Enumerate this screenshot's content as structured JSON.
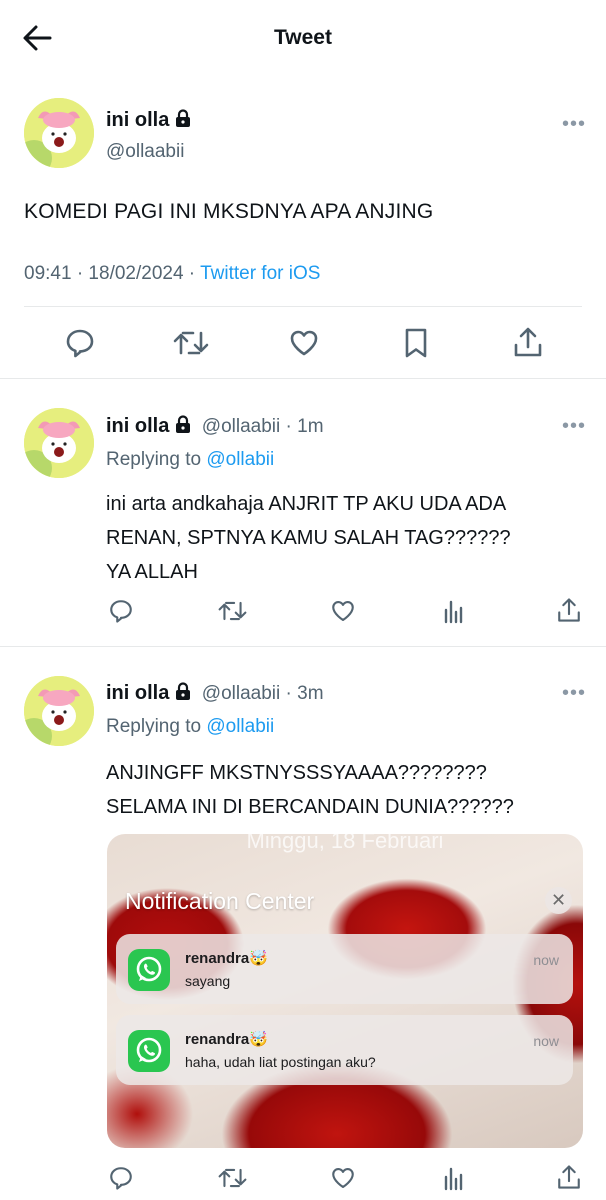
{
  "header": {
    "title": "Tweet"
  },
  "main_tweet": {
    "name": "ini olla",
    "handle": "@ollaabii",
    "text": "KOMEDI PAGI INI MKSDNYA APA ANJING",
    "time": "09:41 · 18/02/2024 · ",
    "source": "Twitter for iOS"
  },
  "reply1": {
    "name": "ini olla",
    "handle": "@ollaabii · 1m",
    "replying_prefix": "Replying to ",
    "replying_to": "@ollabii",
    "line1": "ini arta andkahaja ANJRIT TP AKU UDA ADA",
    "line2": "RENAN, SPTNYA KAMU SALAH TAG??????",
    "line3": "YA ALLAH"
  },
  "reply2": {
    "name": "ini olla",
    "handle": "@ollaabii · 3m",
    "replying_prefix": "Replying to ",
    "replying_to": "@ollabii",
    "line1": "ANJINGFF MKSTNYSSSYAAAA????????",
    "line2": "SELAMA INI DI BERCANDAIN DUNIA??????"
  },
  "media": {
    "date": "Minggu, 18 Februari",
    "title": "Notification Center",
    "close": "✕",
    "notifications": [
      {
        "app_icon": "whatsapp-icon",
        "sender": "renandra🤯",
        "message": "sayang",
        "time": "now"
      },
      {
        "app_icon": "whatsapp-icon",
        "sender": "renandra🤯",
        "message": "haha, udah liat postingan aku?",
        "time": "now"
      }
    ]
  },
  "more_label": "•••",
  "colors": {
    "link": "#1d9bf0",
    "muted": "#536471",
    "text": "#0f1419",
    "whatsapp": "#2ac650"
  }
}
